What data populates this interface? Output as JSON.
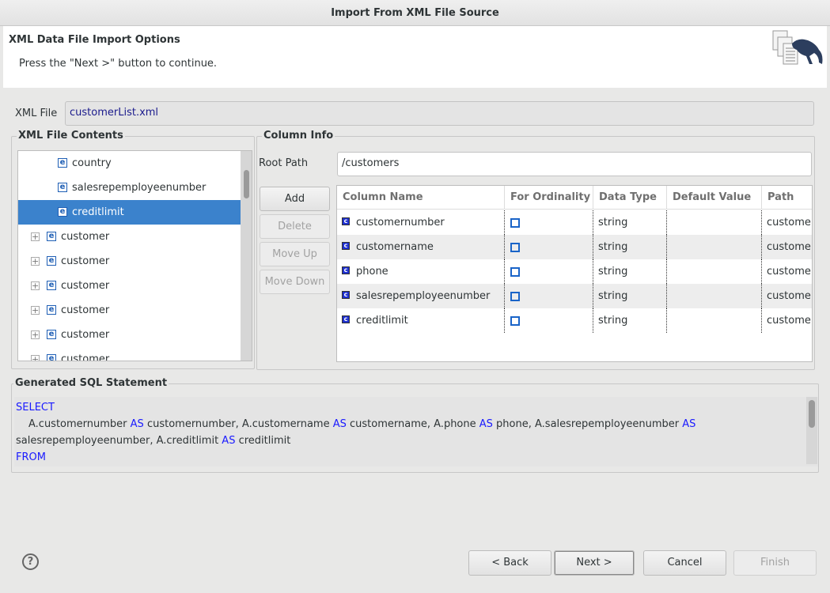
{
  "window": {
    "title": "Import From XML File Source"
  },
  "header": {
    "title": "XML Data File Import Options",
    "message": "Press the \"Next >\" button to continue.",
    "logo": "documents-and-salamander-logo"
  },
  "xml_file": {
    "label": "XML File",
    "value": "customerList.xml"
  },
  "contents": {
    "title": "XML File Contents",
    "items": [
      {
        "label": "country",
        "type": "element",
        "indent": true,
        "selected": false
      },
      {
        "label": "salesrepemployeenumber",
        "type": "element",
        "indent": true,
        "selected": false
      },
      {
        "label": "creditlimit",
        "type": "element",
        "indent": true,
        "selected": true
      },
      {
        "label": "customer",
        "type": "element",
        "expandable": true
      },
      {
        "label": "customer",
        "type": "element",
        "expandable": true
      },
      {
        "label": "customer",
        "type": "element",
        "expandable": true
      },
      {
        "label": "customer",
        "type": "element",
        "expandable": true
      },
      {
        "label": "customer",
        "type": "element",
        "expandable": true
      },
      {
        "label": "customer",
        "type": "element",
        "expandable": true
      }
    ]
  },
  "column_info": {
    "title": "Column Info",
    "root_path_label": "Root Path",
    "root_path": "/customers",
    "buttons": {
      "add": "Add",
      "delete": "Delete",
      "move_up": "Move Up",
      "move_down": "Move Down"
    },
    "headers": [
      "Column Name",
      "For Ordinality",
      "Data Type",
      "Default Value",
      "Path"
    ],
    "rows": [
      {
        "name": "customernumber",
        "ordinality": false,
        "type": "string",
        "default": "",
        "path": "custome"
      },
      {
        "name": "customername",
        "ordinality": false,
        "type": "string",
        "default": "",
        "path": "custome"
      },
      {
        "name": "phone",
        "ordinality": false,
        "type": "string",
        "default": "",
        "path": "custome"
      },
      {
        "name": "salesrepemployeenumber",
        "ordinality": false,
        "type": "string",
        "default": "",
        "path": "custome"
      },
      {
        "name": "creditlimit",
        "ordinality": false,
        "type": "string",
        "default": "",
        "path": "custome"
      }
    ]
  },
  "sql": {
    "title": "Generated SQL Statement",
    "select": "SELECT",
    "line2": [
      [
        "A.customernumber ",
        ""
      ],
      [
        "AS",
        "kw"
      ],
      [
        " customernumber, A.customername ",
        ""
      ],
      [
        "AS",
        "kw"
      ],
      [
        " customername, A.phone ",
        ""
      ],
      [
        "AS",
        "kw"
      ],
      [
        " phone, A.salesrepemployeenumber ",
        ""
      ],
      [
        "AS",
        "kw"
      ]
    ],
    "line3": [
      [
        "salesrepemployeenumber, A.creditlimit ",
        ""
      ],
      [
        "AS",
        "kw"
      ],
      [
        " creditlimit",
        ""
      ]
    ],
    "from": "FROM"
  },
  "footer": {
    "help": "?",
    "back": "< Back",
    "next": "Next >",
    "cancel": "Cancel",
    "finish": "Finish"
  }
}
